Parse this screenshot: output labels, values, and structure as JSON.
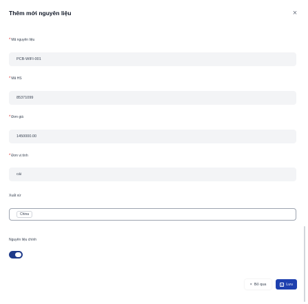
{
  "dialog": {
    "title": "Thêm mới nguyên liệu",
    "close_icon": "×"
  },
  "fields": {
    "material_code": {
      "label": "Mã nguyên liệu",
      "required_mark": "*",
      "value": "PCB-WIFI-001"
    },
    "hs_code": {
      "label": "Mã HS",
      "required_mark": "*",
      "value": "85371099"
    },
    "unit_price": {
      "label": "Đơn giá",
      "required_mark": "*",
      "value": "1450000.00"
    },
    "unit": {
      "label": "Đơn vị tính",
      "required_mark": "*",
      "value": "cái"
    },
    "origin": {
      "label": "Xuất xứ",
      "selected": "China"
    },
    "main_material": {
      "label": "Nguyên liệu chính",
      "enabled": true
    }
  },
  "footer": {
    "cancel_label": "Bỏ qua",
    "cancel_icon": "×",
    "save_label": "Lưu"
  },
  "colors": {
    "primary": "#1e40af",
    "toggle_on": "#1e3a8a",
    "required": "#dc2626"
  }
}
